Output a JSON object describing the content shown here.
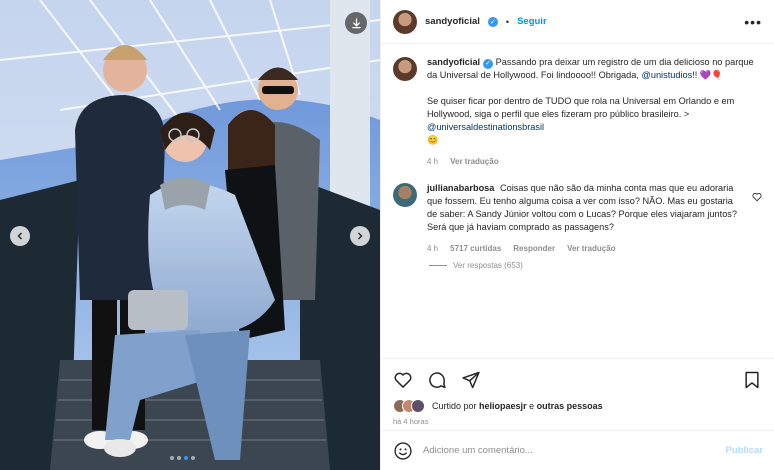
{
  "post": {
    "username": "sandyoficial",
    "follow_label": "Seguir",
    "separator": "•",
    "more_label": "•••"
  },
  "caption": {
    "username": "sandyoficial",
    "text_1": "Passando pra deixar um registro de um dia delicioso no parque da Universal de Hollywood. Foi lindoooo!! Obrigada,",
    "mention_1": "@unistudios!!",
    "emoji_1": "💜🎈",
    "text_2": "Se quiser ficar por dentro de TUDO que rola na Universal em Orlando e em Hollywood, siga o perfil que eles fizeram pro público brasileiro. >",
    "mention_2": "@universaldestinationsbrasil",
    "emoji_2": "😊",
    "time": "4 h",
    "translate": "Ver tradução"
  },
  "comment": {
    "username": "jullianabarbosa",
    "text": "Coisas que não são da minha conta mas que eu adoraria que fossem. Eu tenho alguma coisa a ver com isso? NÃO. Mas eu gostaria de saber: A Sandy Júnior voltou com o Lucas? Porque eles viajaram juntos? Será que já haviam comprado as passagens?",
    "time": "4 h",
    "likes": "5717 curtidas",
    "reply": "Responder",
    "translate": "Ver tradução",
    "view_replies": "Ver respostas (653)"
  },
  "likes": {
    "prefix": "Curtido por",
    "user": "heliopaesjr",
    "middle": "e",
    "others": "outras pessoas"
  },
  "timestamp": "há 4 horas",
  "add_comment": {
    "placeholder": "Adicione um comentário...",
    "publish": "Publicar"
  },
  "colors": {
    "accent": "#0095f6",
    "verified": "#3897f0",
    "link": "#00376b",
    "muted": "#8e8e8e"
  },
  "icons": {
    "download": "download-icon",
    "prev": "chevron-left-icon",
    "next": "chevron-right-icon",
    "like": "heart-icon",
    "comment": "comment-icon",
    "share": "paper-plane-icon",
    "save": "bookmark-icon",
    "emoji": "smiley-icon"
  }
}
